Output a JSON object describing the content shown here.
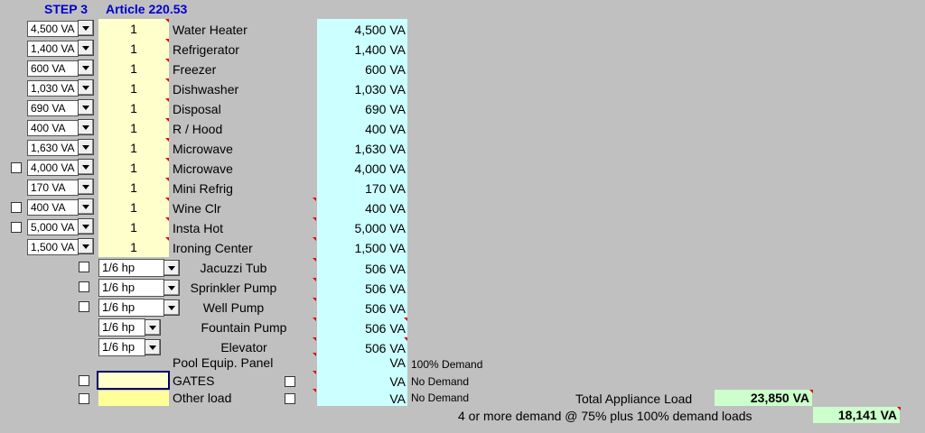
{
  "header": {
    "step": "STEP 3",
    "article": "Article 220.53"
  },
  "appliances": [
    {
      "rating": "4,500 VA",
      "qty": "1",
      "name": "Water Heater",
      "va": "4,500 VA",
      "check": false
    },
    {
      "rating": "1,400 VA",
      "qty": "1",
      "name": "Refrigerator",
      "va": "1,400 VA",
      "check": false
    },
    {
      "rating": "600 VA",
      "qty": "1",
      "name": "Freezer",
      "va": "600 VA",
      "check": false
    },
    {
      "rating": "1,030 VA",
      "qty": "1",
      "name": "Dishwasher",
      "va": "1,030 VA",
      "check": false
    },
    {
      "rating": "690 VA",
      "qty": "1",
      "name": "Disposal",
      "va": "690 VA",
      "check": false
    },
    {
      "rating": "400 VA",
      "qty": "1",
      "name": "R / Hood",
      "va": "400 VA",
      "check": false
    },
    {
      "rating": "1,630 VA",
      "qty": "1",
      "name": "Microwave",
      "va": "1,630 VA",
      "check": false
    },
    {
      "rating": "4,000 VA",
      "qty": "1",
      "name": "Microwave",
      "va": "4,000 VA",
      "check": true
    },
    {
      "rating": "170 VA",
      "qty": "1",
      "name": "Mini Refrig",
      "va": "170 VA",
      "check": false
    },
    {
      "rating": "400 VA",
      "qty": "1",
      "name": "Wine Clr",
      "va": "400 VA",
      "check": true
    },
    {
      "rating": "5,000 VA",
      "qty": "1",
      "name": "Insta Hot",
      "va": "5,000 VA",
      "check": true
    },
    {
      "rating": "1,500 VA",
      "qty": "1",
      "name": "Ironing Center",
      "va": "1,500 VA",
      "check": false
    }
  ],
  "motors": [
    {
      "hp": "1/6 hp",
      "name": "Jacuzzi Tub",
      "va": "506 VA",
      "check": true,
      "wide": true
    },
    {
      "hp": "1/6 hp",
      "name": "Sprinkler Pump",
      "va": "506 VA",
      "check": true,
      "wide": true
    },
    {
      "hp": "1/6 hp",
      "name": "Well Pump",
      "va": "506 VA",
      "check": true,
      "wide": true
    },
    {
      "hp": "1/6 hp",
      "name": "Fountain Pump",
      "va": "506 VA",
      "check": false,
      "wide": false
    },
    {
      "hp": "1/6 hp",
      "name": "Elevator",
      "va": "506 VA",
      "check": false,
      "wide": false
    }
  ],
  "extras": [
    {
      "name": "Pool Equip. Panel",
      "va": "VA",
      "demand": "100% Demand"
    },
    {
      "name": "GATES",
      "va": "VA",
      "demand": "No Demand"
    },
    {
      "name": "Other load",
      "va": "VA",
      "demand": "No Demand"
    }
  ],
  "totals": {
    "appliance_label": "Total Appliance Load",
    "appliance_value": "23,850 VA",
    "demand_label": "4 or more demand @ 75% plus 100% demand loads",
    "demand_value": "18,141 VA"
  },
  "colors": {
    "background": "#c0c0c0",
    "input": "#ffffcc",
    "result": "#ccffff",
    "total": "#ccffcc",
    "header": "#0000cc"
  }
}
